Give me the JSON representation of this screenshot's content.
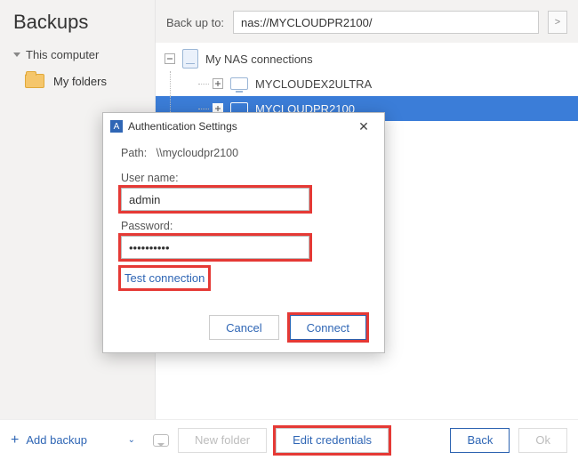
{
  "sidebar": {
    "title": "Backups",
    "group_label": "This computer",
    "items": [
      {
        "label": "My folders"
      }
    ]
  },
  "topbar": {
    "label": "Back up to:",
    "path_value": "nas://MYCLOUDPR2100/",
    "go_glyph": ">"
  },
  "tree": {
    "root_label": "My NAS connections",
    "items": [
      {
        "label": "MYCLOUDEX2ULTRA",
        "selected": false
      },
      {
        "label": "MYCLOUDPR2100",
        "selected": true
      }
    ]
  },
  "modal": {
    "app_icon_letter": "A",
    "title": "Authentication Settings",
    "close_glyph": "✕",
    "path_label": "Path:",
    "path_value": "\\\\mycloudpr2100",
    "username_label": "User name:",
    "username_value": "admin",
    "password_label": "Password:",
    "password_value": "••••••••••",
    "test_label": "Test connection",
    "cancel_label": "Cancel",
    "connect_label": "Connect"
  },
  "bottom": {
    "add_label": "Add backup",
    "add_plus": "+",
    "add_chevron": "⌄",
    "new_folder_label": "New folder",
    "edit_credentials_label": "Edit credentials",
    "back_label": "Back",
    "ok_label": "Ok"
  }
}
